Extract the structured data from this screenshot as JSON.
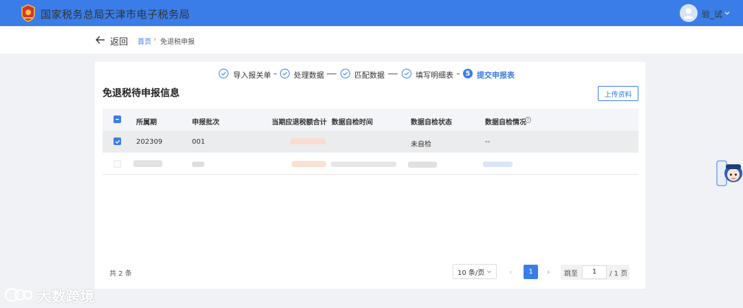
{
  "header": {
    "brand": "国家税务总局天津市电子税务局",
    "user_name": "验_试",
    "colors": {
      "primary": "#3a7de8"
    }
  },
  "breadcrumb": {
    "back": "返回",
    "home": "首页",
    "separator": "›",
    "current": "免退税申报"
  },
  "steps": [
    {
      "label": "导入报关单",
      "state": "done"
    },
    {
      "label": "处理数据",
      "state": "done"
    },
    {
      "label": "匹配数据",
      "state": "done"
    },
    {
      "label": "填写明细表",
      "state": "done"
    },
    {
      "number": "5",
      "label": "提交申报表",
      "state": "active"
    }
  ],
  "section": {
    "title": "免退税待申报信息",
    "upload_button": "上传资料"
  },
  "table": {
    "columns": [
      "所属期",
      "申报批次",
      "当期应退税额合计",
      "数据自检时间",
      "数据自检状态",
      "数据自检情况"
    ],
    "rows": [
      {
        "checked": true,
        "period": "202309",
        "batch": "001",
        "amount": "",
        "check_time": "",
        "check_status": "未自检",
        "check_detail": "--"
      },
      {
        "checked": false,
        "period": "",
        "batch": "",
        "amount": "",
        "check_time": "",
        "check_status": "",
        "check_detail": ""
      }
    ]
  },
  "pagination": {
    "total": "共 2 条",
    "page_size": "10 条/页",
    "prev": "‹",
    "current_page": "1",
    "next": "›",
    "jump_label": "跳至",
    "jump_value": "1",
    "total_pages": "/ 1 页"
  },
  "watermark": "大数跨境"
}
